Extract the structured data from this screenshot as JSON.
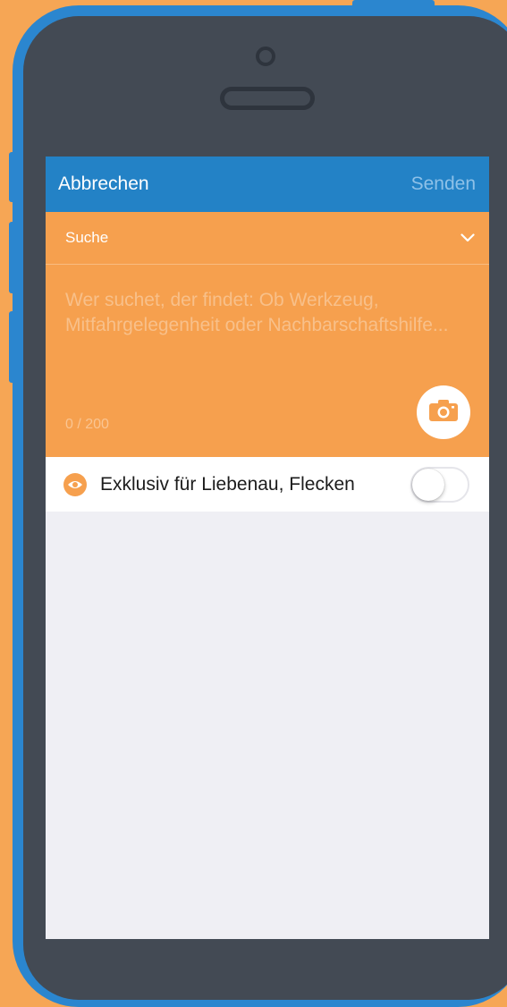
{
  "navbar": {
    "cancel_label": "Abbrechen",
    "send_label": "Senden"
  },
  "compose": {
    "category": "Suche",
    "category_icon": "chevron-down-icon",
    "placeholder": "Wer suchet, der findet: Ob Werkzeug, Mitfahrgelegenheit oder Nachbarschaftshilfe...",
    "counter": "0 / 200",
    "camera_icon": "camera-icon"
  },
  "visibility": {
    "icon": "eye-icon",
    "label": "Exklusiv für Liebenau, Flecken",
    "enabled": false
  },
  "colors": {
    "background": "#F6A655",
    "phone_frame": "#2B86CF",
    "navbar": "#2382C6",
    "compose": "#F6A04E",
    "screen_bg": "#EFEFF4"
  }
}
